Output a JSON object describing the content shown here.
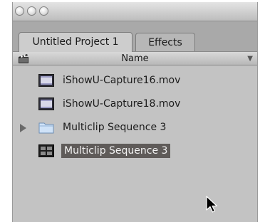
{
  "tabs": [
    {
      "label": "Untitled Project 1",
      "active": true
    },
    {
      "label": "Effects",
      "active": false
    }
  ],
  "column_header": {
    "name_label": "Name",
    "clapper_icon": "clapperboard-icon",
    "sort_icon": "sort-arrow-icon"
  },
  "items": [
    {
      "label": "iShowU-Capture16.mov",
      "icon": "video-clip-icon",
      "selected": false,
      "expandable": false
    },
    {
      "label": "iShowU-Capture18.mov",
      "icon": "video-clip-icon",
      "selected": false,
      "expandable": false
    },
    {
      "label": "Multiclip Sequence 3",
      "icon": "folder-icon",
      "selected": false,
      "expandable": true
    },
    {
      "label": "Multiclip Sequence 3",
      "icon": "multiclip-icon",
      "selected": true,
      "expandable": false
    }
  ],
  "colors": {
    "selection": "#5f5b59",
    "panel": "#c3c3c3"
  }
}
